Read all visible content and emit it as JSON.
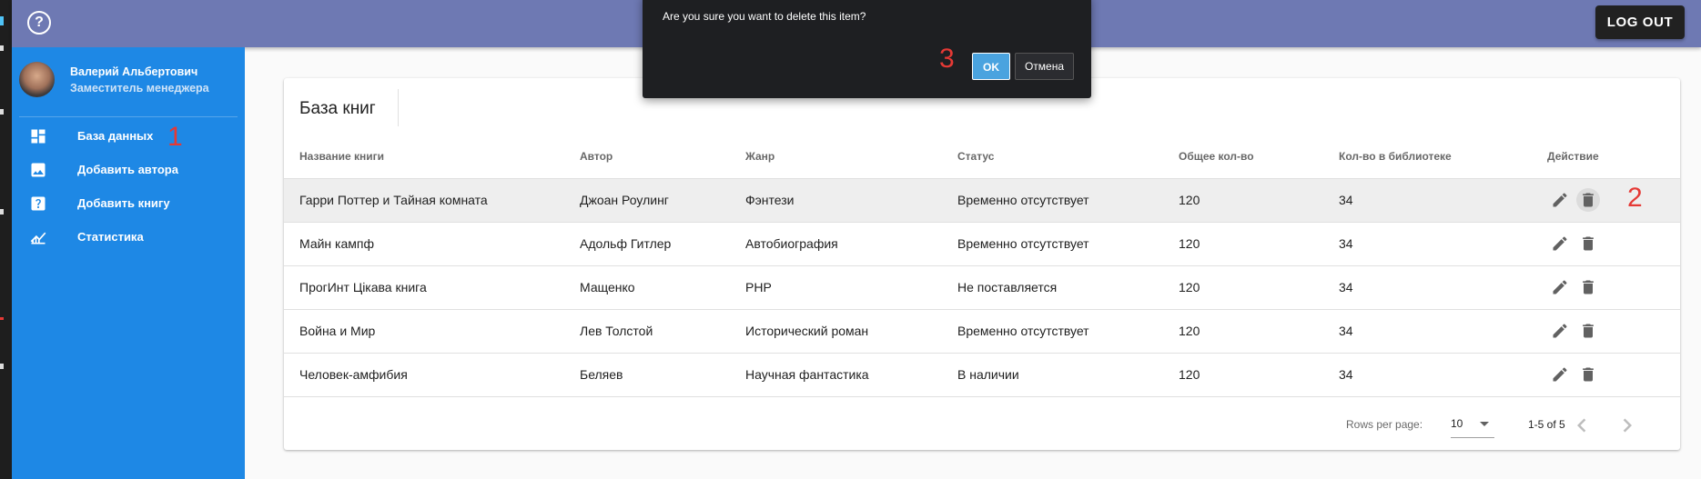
{
  "header": {
    "help_icon": "help-circle-icon",
    "logout_label": "LOG OUT",
    "bar_color": "#6e79b3"
  },
  "sidebar": {
    "color": "#1e88e5",
    "user": {
      "name": "Валерий Альбертович",
      "role": "Заместитель менеджера"
    },
    "items": [
      {
        "label": "База данных",
        "icon": "dashboard-icon"
      },
      {
        "label": "Добавить автора",
        "icon": "image-icon"
      },
      {
        "label": "Добавить книгу",
        "icon": "help-box-icon"
      },
      {
        "label": "Статистика",
        "icon": "chart-icon"
      }
    ]
  },
  "annotations": {
    "one": "1",
    "two": "2",
    "three": "3"
  },
  "table": {
    "title": "База книг",
    "headers": [
      "Название книги",
      "Автор",
      "Жанр",
      "Статус",
      "Общее кол-во",
      "Кол-во в библиотеке",
      "Действие"
    ],
    "rows": [
      {
        "title": "Гарри Поттер и Тайная комната",
        "author": "Джоан Роулинг",
        "genre": "Фэнтези",
        "status": "Временно отсутствует",
        "total": "120",
        "in_library": "34"
      },
      {
        "title": "Майн кампф",
        "author": "Адольф Гитлер",
        "genre": "Автобиография",
        "status": "Временно отсутствует",
        "total": "120",
        "in_library": "34"
      },
      {
        "title": "ПрогИнт Цікава книга",
        "author": "Мащенко",
        "genre": "PHP",
        "status": "Не поставляется",
        "total": "120",
        "in_library": "34"
      },
      {
        "title": "Война и Мир",
        "author": "Лев Толстой",
        "genre": "Исторический роман",
        "status": "Временно отсутствует",
        "total": "120",
        "in_library": "34"
      },
      {
        "title": "Человек-амфибия",
        "author": "Беляев",
        "genre": "Научная фантастика",
        "status": "В наличии",
        "total": "120",
        "in_library": "34"
      }
    ],
    "footer": {
      "rows_per_page_label": "Rows per page:",
      "rows_per_page_value": "10",
      "page_info": "1-5 of 5"
    }
  },
  "dialog": {
    "message": "Are you sure you want to delete this item?",
    "ok_label": "OK",
    "cancel_label": "Отмена"
  }
}
